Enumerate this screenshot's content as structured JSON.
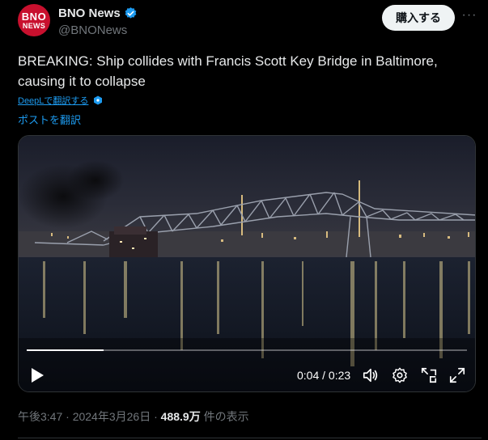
{
  "author": {
    "avatar_line1": "BNO",
    "avatar_line2": "NEWS",
    "name": "BNO News",
    "handle": "@BNONews",
    "verified_color": "#1d9bf0"
  },
  "actions": {
    "buy_label": "購入する",
    "more_label": "···"
  },
  "tweet": {
    "text": "BREAKING: Ship collides with Francis Scott Key Bridge in Baltimore, causing it to collapse",
    "deepl_label": "DeepLで翻訳する",
    "translate_label": "ポストを翻訳"
  },
  "video": {
    "current_time": "0:04",
    "duration": "0:23",
    "time_display": "0:04 / 0:23",
    "progress_fraction": 0.174,
    "icons": [
      "play-icon",
      "volume-icon",
      "settings-icon",
      "picture-in-picture-icon",
      "fullscreen-icon"
    ]
  },
  "meta": {
    "time": "午後3:47",
    "date": "2024年3月26日",
    "views_count": "488.9万",
    "views_label": "件の表示"
  },
  "colors": {
    "accent": "#1d9bf0",
    "background": "#000000",
    "text": "#e7e9ea",
    "muted": "#71767b",
    "avatar": "#c8102e"
  }
}
